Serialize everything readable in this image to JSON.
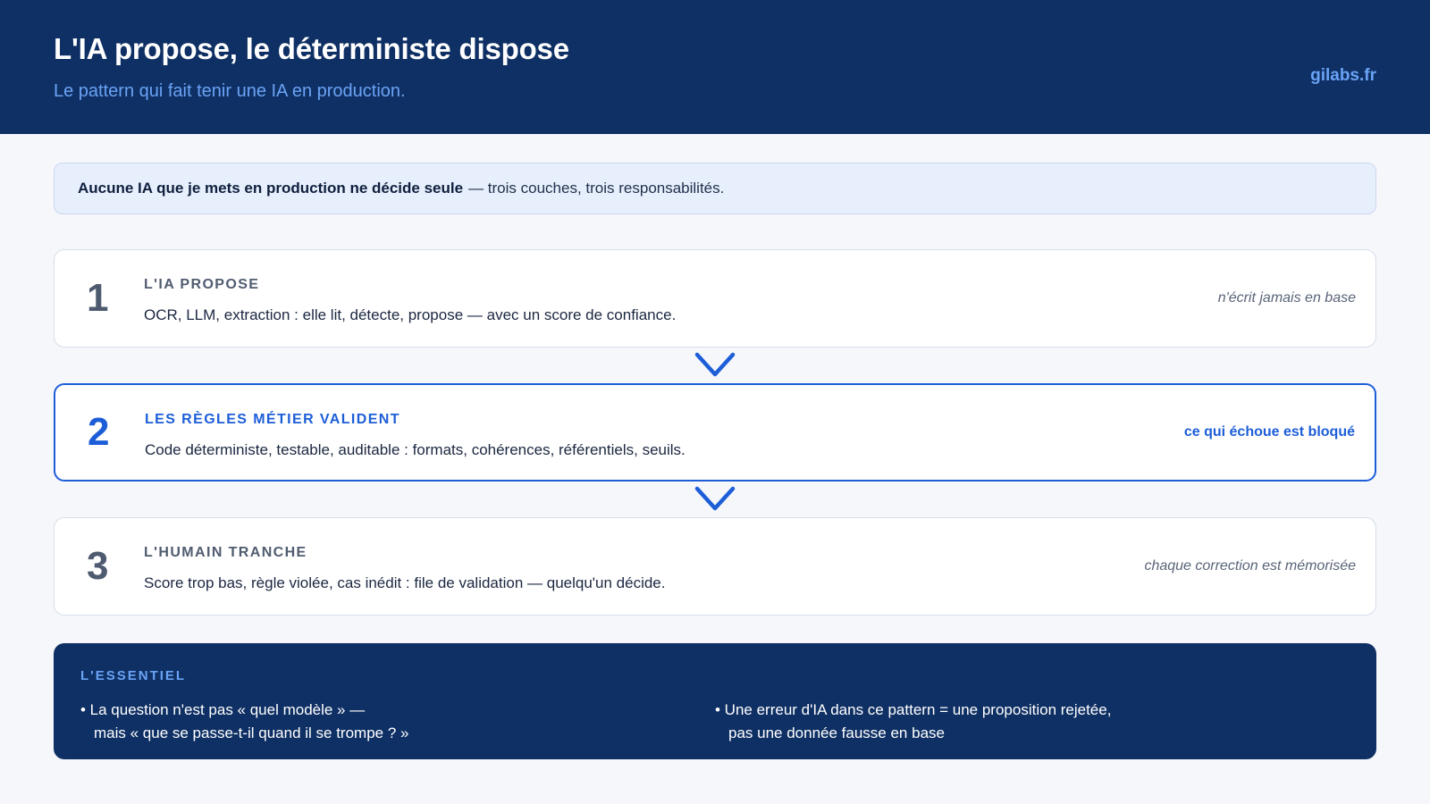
{
  "header": {
    "title": "L'IA propose, le déterministe dispose",
    "subtitle": "Le pattern qui fait tenir une IA en production.",
    "brand": "gilabs.fr"
  },
  "intro": {
    "bold": "Aucune IA que je mets en production ne décide seule",
    "rest": "— trois couches, trois responsabilités."
  },
  "steps": [
    {
      "number": "1",
      "label": "L'IA propose",
      "description": "OCR, LLM, extraction : elle lit, détecte, propose — avec un score de confiance.",
      "note": "n'écrit jamais en base"
    },
    {
      "number": "2",
      "label": "Les règles métier valident",
      "description": "Code déterministe, testable, auditable : formats, cohérences, référentiels, seuils.",
      "note": "ce qui échoue est bloqué"
    },
    {
      "number": "3",
      "label": "L'humain tranche",
      "description": "Score trop bas, règle violée, cas inédit : file de validation — quelqu'un décide.",
      "note": "chaque correction est mémorisée"
    }
  ],
  "summary": {
    "title": "L'ESSENTIEL",
    "left_line1": "• La question n'est pas « quel modèle » —",
    "left_line2": "mais « que se passe-t-il quand il se trompe ? »",
    "right_line1": "• Une erreur d'IA dans ce pattern = une proposition rejetée,",
    "right_line2": "pas une donnée fausse en base"
  },
  "colors": {
    "header_bg": "#0f3064",
    "accent": "#1d5ed8",
    "accent_light": "#6aa3f5",
    "page_bg": "#f5f7fb"
  }
}
